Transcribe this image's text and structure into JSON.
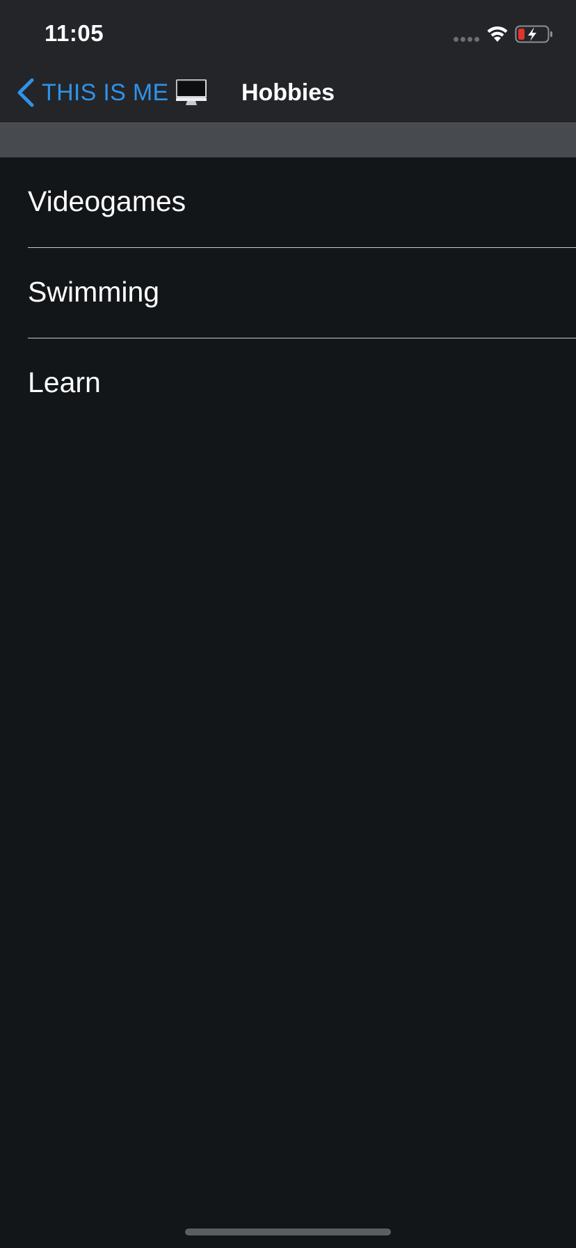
{
  "status_bar": {
    "time": "11:05",
    "icons": [
      "signal-dots-icon",
      "wifi-icon",
      "battery-charging-icon"
    ],
    "battery_color": "#e0342c"
  },
  "nav": {
    "back_label": "THIS IS ME",
    "back_icon": "chevron-left-icon",
    "back_emoji_icon": "desktop-computer-icon",
    "title": "Hobbies",
    "accent_color": "#2f93e8"
  },
  "hobbies": [
    {
      "label": "Videogames"
    },
    {
      "label": "Swimming"
    },
    {
      "label": "Learn"
    }
  ]
}
